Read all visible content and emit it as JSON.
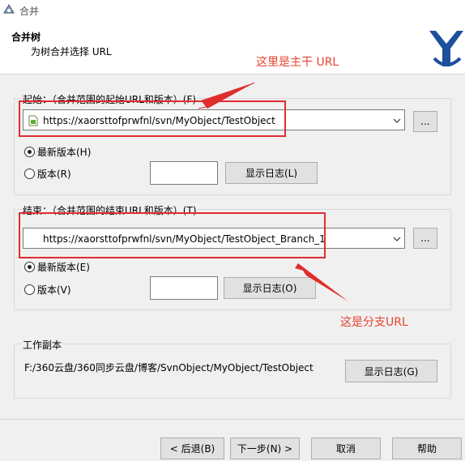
{
  "window": {
    "title": "合并"
  },
  "header": {
    "title": "合并树",
    "subtitle": "为树合并选择 URL"
  },
  "annotations": {
    "trunk_note": "这里是主干 URL",
    "branch_note": "这是分支URL"
  },
  "start_section": {
    "label": "起始：（合并范围的起始URL和版本）(F)",
    "url": "https://xaorsttofprwfnl/svn/MyObject/TestObject",
    "browse_label": "...",
    "head_revision_label": "最新版本(H)",
    "revision_label": "版本(R)",
    "revision_value": "",
    "show_log_label": "显示日志(L)",
    "head_selected": true
  },
  "end_section": {
    "label": "结束：（合并范围的结束URL和版本）(T)",
    "url": "https://xaorsttofprwfnl/svn/MyObject/TestObject_Branch_1",
    "browse_label": "...",
    "head_revision_label": "最新版本(E)",
    "revision_label": "版本(V)",
    "revision_value": "",
    "show_log_label": "显示日志(O)",
    "head_selected": true
  },
  "working_copy": {
    "label": "工作副本",
    "path": "F:/360云盘/360同步云盘/博客/SvnObject/MyObject/TestObject",
    "show_log_label": "显示日志(G)"
  },
  "footer": {
    "back_label": "< 后退(B)",
    "next_label": "下一步(N) >",
    "cancel_label": "取消",
    "help_label": "帮助"
  },
  "colors": {
    "annotation_red": "#e8412f",
    "highlight_box": "#e02d2d",
    "logo_blue": "#1d4f9c"
  }
}
